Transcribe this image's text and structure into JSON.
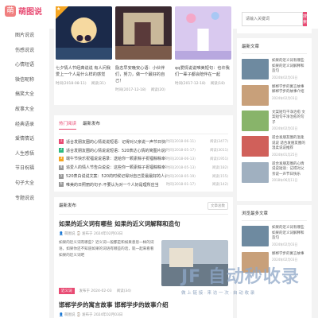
{
  "logo": {
    "mark": "萌",
    "text": "萌图说"
  },
  "sidebar": {
    "items": [
      "图片说说",
      "伤感说说",
      "心情短语",
      "微信昵称",
      "搞笑大全",
      "故事大全",
      "经典语录",
      "爱情情话",
      "人生感悟",
      "节日祝福",
      "句子大全",
      "专题说说"
    ]
  },
  "slider": [
    {
      "title": "七夕情人节经典说说 有人问我爱上一个人是什么样的感觉",
      "date": "时间(2018-08-11)",
      "views": "阅读(31)",
      "badge": "★"
    },
    {
      "title": "励志早安晚安心语：小伙伴们，努力，做一个最好的自己！",
      "date": "时间(2017-12-18)",
      "views": "阅读(20)"
    },
    {
      "title": "qq爱情说说唯美短句：也许我们一辈子都会陪伴在一起",
      "date": "时间(2017-12-18)",
      "views": "阅读(18)"
    }
  ],
  "tabs": {
    "active": "热门阅读",
    "inactive": "最新发布"
  },
  "ranking": [
    {
      "num": "1",
      "color": "#e84b73",
      "title": "适合发朋友圈的心情说说短语：记得对父亲说一声节日快乐",
      "date": "时间(2018-06-11)",
      "views": "阅读(3477)"
    },
    {
      "num": "2",
      "color": "#2db97f",
      "title": "适合发朋友圈的心情说说短语：520表达心情的简图片说说短语带表情",
      "date": "时间(2018-05-17)",
      "views": "阅读(3011)"
    },
    {
      "num": "3",
      "color": "#f5a623",
      "title": "端午节快乐祝福说说语录：送给你一颗素粽子祝福粽粽幸福快乐",
      "date": "时间(2018-06-13)",
      "views": "阅读(1951)"
    },
    {
      "num": "4",
      "color": "#999999",
      "title": "追爱人的情人节告白说说：这些你一颗素粽子祝福粽粽幸福快乐",
      "date": "时间(2018-05-13)",
      "views": "阅读(182)"
    },
    {
      "num": "5",
      "color": "#999999",
      "title": "520表白说说文案：520的时候记得对自己爱最最好的人说一声我爱你",
      "date": "时间(2018-05-19)",
      "views": "阅读(155)"
    },
    {
      "num": "6",
      "color": "#999999",
      "title": "唯美的日照丽的句子:不要认为对一个人好是理所应当",
      "date": "时间(2018-01-17)",
      "views": "阅读(142)"
    }
  ],
  "latest": {
    "heading": "最新发布",
    "more": "文章总数",
    "post1": {
      "title": "如果的近义词有哪些 如果的近义词解释和造句",
      "author": "萌图说",
      "date": "发布于 2024年02月03日",
      "text": "如果的近义词有哪些？近义词一般都是和如果意思一样的词语，如果你还不知道如果的词语有哪些的话，就一起来看看如果的近义词吧",
      "tag": "近义词",
      "foot_date": "发布于 2024-02-03",
      "foot_views": "阅读(34)"
    },
    "post2": {
      "title": "邯郸学步的寓言故事 邯郸学步的故事介绍",
      "author": "萌图说",
      "date": "发布于 2024年02月03日"
    }
  },
  "search": {
    "placeholder": "请输入关键词",
    "button": "搜索"
  },
  "recent_articles": {
    "heading": "最新文章",
    "items": [
      {
        "text": "如果的近义词有哪些 如果的近义词解释和造句",
        "date": "2024年02月03日"
      },
      {
        "text": "邯郸学步的寓言故事 邯郸学步的故事介绍",
        "date": "2024年02月03日"
      },
      {
        "text": "文案短句干净治愈 文案短句干净治愈的句子",
        "date": "2024年02月02日"
      },
      {
        "text": "适合发朋友圈的温柔说说 适合发朋友圈的温柔说说推荐",
        "date": "2024年01月25日"
      },
      {
        "text": "适合发朋友圈的心情说说短语：记得对父亲说一声节日快乐",
        "date": "2018年06月11日"
      }
    ]
  },
  "browse": {
    "heading": "浏览最多文章",
    "items": [
      {
        "text": "如果的近义词有哪些 如果的近义词解释和造句",
        "date": "2024年02月03日"
      },
      {
        "text": "邯郸学步的寓言故事",
        "date": "2024年02月03日"
      }
    ]
  },
  "watermark": {
    "main": "JF 自动秒收录",
    "sub": "做 上 链 接 · 来 访 一 次 · 自 动 收 录"
  }
}
